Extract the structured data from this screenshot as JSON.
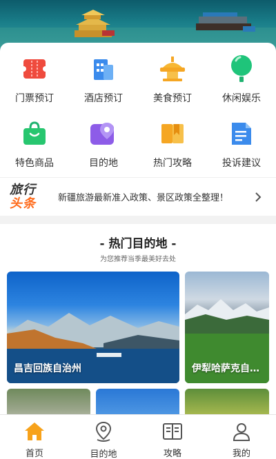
{
  "grid": {
    "items": [
      {
        "label": "门票预订",
        "icon": "ticket-icon"
      },
      {
        "label": "酒店预订",
        "icon": "hotel-icon"
      },
      {
        "label": "美食预订",
        "icon": "food-icon"
      },
      {
        "label": "休闲娱乐",
        "icon": "balloon-icon"
      },
      {
        "label": "特色商品",
        "icon": "shopping-bag-icon"
      },
      {
        "label": "目的地",
        "icon": "map-pin-icon"
      },
      {
        "label": "热门攻略",
        "icon": "guide-book-icon"
      },
      {
        "label": "投诉建议",
        "icon": "complaint-doc-icon"
      }
    ]
  },
  "news": {
    "logo_line1": "旅行",
    "logo_line2": "头条",
    "text": "新疆旅游最新准入政策、景区政策全整理！"
  },
  "section": {
    "title": "- 热门目的地 -",
    "subtitle": "为您推荐当季最美好去处",
    "destinations": [
      {
        "label": "昌吉回族自治州"
      },
      {
        "label": "伊犁哈萨克自…"
      }
    ]
  },
  "tabbar": {
    "tabs": [
      {
        "label": "首页",
        "icon": "home-icon",
        "active": true
      },
      {
        "label": "目的地",
        "icon": "location-icon",
        "active": false
      },
      {
        "label": "攻略",
        "icon": "book-icon",
        "active": false
      },
      {
        "label": "我的",
        "icon": "user-icon",
        "active": false
      }
    ]
  },
  "colors": {
    "accent_orange": "#f7a21b",
    "news_orange": "#ff6a1a"
  }
}
